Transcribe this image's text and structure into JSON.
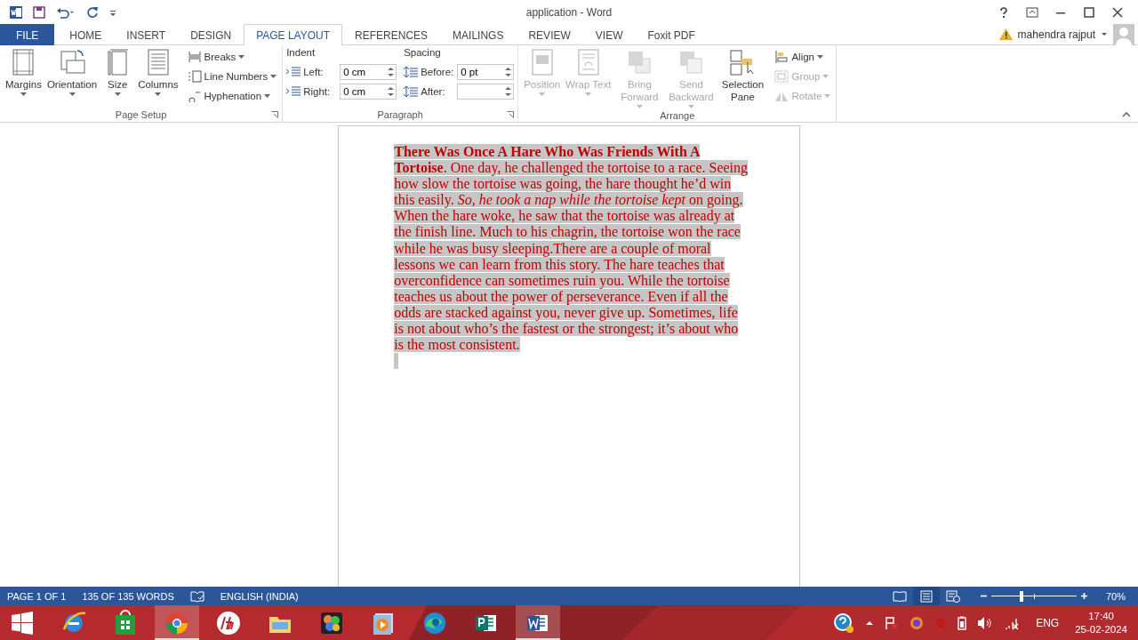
{
  "window": {
    "title": "application - Word"
  },
  "tabs": [
    {
      "label": "FILE",
      "kind": "file",
      "selected": false
    },
    {
      "label": "HOME",
      "kind": "tab",
      "selected": false
    },
    {
      "label": "INSERT",
      "kind": "tab",
      "selected": false
    },
    {
      "label": "DESIGN",
      "kind": "tab",
      "selected": false
    },
    {
      "label": "PAGE LAYOUT",
      "kind": "tab",
      "selected": true
    },
    {
      "label": "REFERENCES",
      "kind": "tab",
      "selected": false
    },
    {
      "label": "MAILINGS",
      "kind": "tab",
      "selected": false
    },
    {
      "label": "REVIEW",
      "kind": "tab",
      "selected": false
    },
    {
      "label": "VIEW",
      "kind": "tab",
      "selected": false
    },
    {
      "label": "Foxit PDF",
      "kind": "tab",
      "selected": false
    }
  ],
  "account": {
    "name": "mahendra rajput"
  },
  "page_setup": {
    "label": "Page Setup",
    "large_buttons": [
      {
        "label": "Margins",
        "kind": "margins"
      },
      {
        "label": "Orientation",
        "kind": "orientation"
      },
      {
        "label": "Size",
        "kind": "size"
      },
      {
        "label": "Columns",
        "kind": "columns"
      }
    ],
    "small_buttons": [
      {
        "label": "Breaks",
        "kind": "breaks"
      },
      {
        "label": "Line Numbers",
        "kind": "line-numbers"
      },
      {
        "label": "Hyphenation",
        "kind": "hyphenation"
      }
    ]
  },
  "paragraph": {
    "label": "Paragraph",
    "indent_label": "Indent",
    "spacing_label": "Spacing",
    "indent": [
      {
        "label": "Left:",
        "value": "0 cm"
      },
      {
        "label": "Right:",
        "value": "0 cm"
      }
    ],
    "spacing": [
      {
        "label": "Before:",
        "value": "0 pt"
      },
      {
        "label": "After:"
      }
    ]
  },
  "arrange": {
    "label": "Arrange",
    "large_buttons": [
      {
        "label": "Position",
        "kind": "position",
        "disabled": true
      },
      {
        "label": "Wrap Text",
        "kind": "wrap",
        "disabled": true
      },
      {
        "label": "Bring Forward",
        "kind": "forward",
        "disabled": true
      },
      {
        "label": "Send Backward",
        "kind": "backward",
        "disabled": true
      },
      {
        "label": "Selection Pane",
        "kind": "selection",
        "disabled": false
      }
    ],
    "small_buttons": [
      {
        "label": "Align",
        "kind": "align",
        "disabled": false
      },
      {
        "label": "Group",
        "kind": "group",
        "disabled": true
      },
      {
        "label": "Rotate",
        "kind": "rotate",
        "disabled": true
      }
    ]
  },
  "document": {
    "selected": true,
    "text": "**There Was Once A Hare Who Was Friends With A Tortoise**. One day, he challenged the tortoise to a race. Seeing how slow the tortoise was going, the hare thought he’d win this easily. *So, he took a nap while the tortoise kept* on going. When the hare woke, he saw that the tortoise was already at the finish line. Much to his chagrin, the tortoise won the race while he was busy sleeping.There are a couple of moral lessons we can learn from this story. The hare teaches that overconfidence can sometimes ruin you. While the tortoise teaches us about the power of perseverance. Even if all the odds are stacked against you, never give up. Sometimes, life is not about who’s the fastest or the strongest; it’s about who is the most consistent."
  },
  "status_bar": {
    "page": "PAGE 1 OF 1",
    "words": "135 OF 135 WORDS",
    "language": "ENGLISH (INDIA)",
    "views": [
      {
        "kind": "read",
        "selected": false
      },
      {
        "kind": "print",
        "selected": true
      },
      {
        "kind": "web",
        "selected": false
      }
    ],
    "zoom": {
      "level": 0.35,
      "reading": "70%"
    }
  },
  "taskbar": {
    "apps": [
      {
        "kind": "ie",
        "selected": false
      },
      {
        "kind": "store",
        "selected": false
      },
      {
        "kind": "chrome",
        "selected": true
      },
      {
        "kind": "hp",
        "selected": false
      },
      {
        "kind": "folder",
        "selected": false
      },
      {
        "kind": "paint",
        "selected": false
      },
      {
        "kind": "media",
        "selected": false
      },
      {
        "kind": "edge",
        "selected": false
      },
      {
        "kind": "publisher",
        "selected": false
      },
      {
        "kind": "word",
        "selected": true
      }
    ],
    "language": "ENG",
    "time": "17:40",
    "date": "25-02-2024"
  }
}
